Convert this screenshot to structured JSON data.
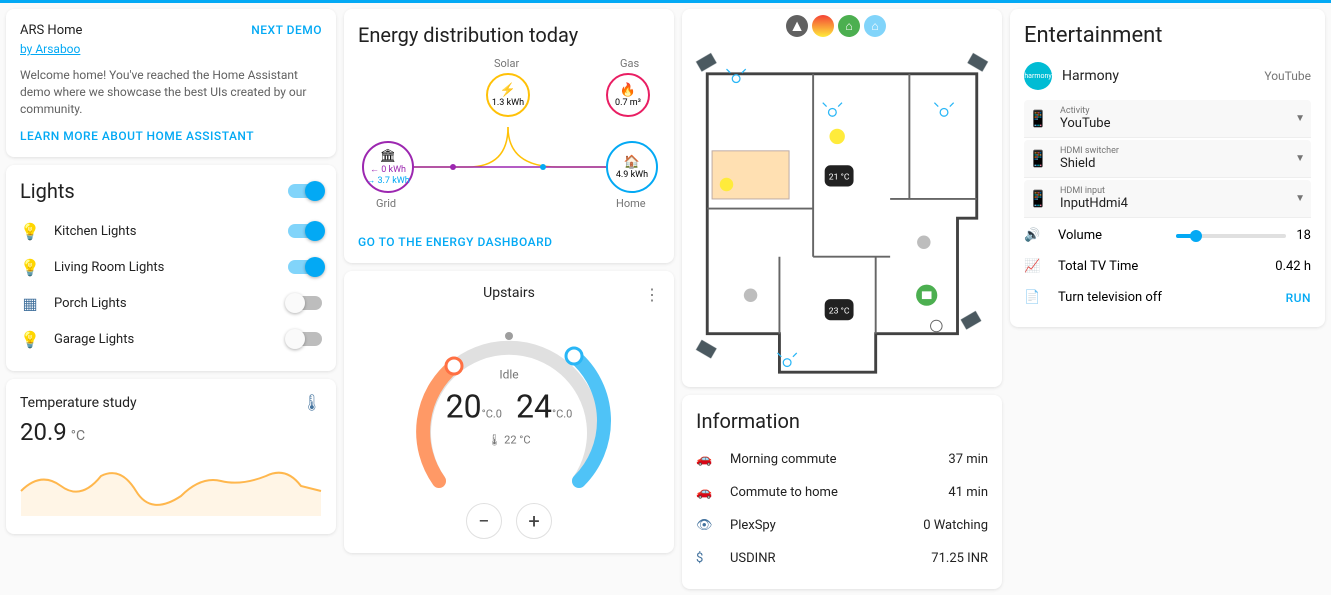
{
  "welcome": {
    "title": "ARS Home",
    "author": "by Arsaboo",
    "next_demo": "NEXT DEMO",
    "description": "Welcome home! You've reached the Home Assistant demo where we showcase the best UIs created by our community.",
    "learn_more": "LEARN MORE ABOUT HOME ASSISTANT"
  },
  "lights": {
    "title": "Lights",
    "master_on": true,
    "items": [
      {
        "name": "Kitchen Lights",
        "on": true,
        "color": "#ffb74d"
      },
      {
        "name": "Living Room Lights",
        "on": true,
        "color": "#ffc107"
      },
      {
        "name": "Porch Lights",
        "on": false,
        "color": "#44739e"
      },
      {
        "name": "Garage Lights",
        "on": false,
        "color": "#44739e"
      }
    ]
  },
  "temperature": {
    "title": "Temperature study",
    "value": "20.9",
    "unit": "°C"
  },
  "energy": {
    "title": "Energy distribution today",
    "solar_label": "Solar",
    "solar_value": "1.3 kWh",
    "gas_label": "Gas",
    "gas_value": "0.7 m³",
    "grid_label": "Grid",
    "grid_in": "← 0 kWh",
    "grid_out": "→ 3.7 kWh",
    "home_label": "Home",
    "home_value": "4.9 kWh",
    "link": "GO TO THE ENERGY DASHBOARD"
  },
  "thermostat": {
    "title": "Upstairs",
    "mode": "Idle",
    "low": "20",
    "high": "24",
    "dec": ".0",
    "unit_sup": "°C",
    "current_icon": "🌡",
    "current": "22 °C"
  },
  "floorplan": {
    "temps": {
      "living": "21 °C",
      "bedroom": "23 °C"
    }
  },
  "info": {
    "title": "Information",
    "rows": [
      {
        "icon": "car",
        "label": "Morning commute",
        "value": "37 min"
      },
      {
        "icon": "car",
        "label": "Commute to home",
        "value": "41 min"
      },
      {
        "icon": "eye",
        "label": "PlexSpy",
        "value": "0 Watching"
      },
      {
        "icon": "dollar",
        "label": "USDINR",
        "value": "71.25 INR"
      }
    ]
  },
  "entertainment": {
    "title": "Entertainment",
    "device": "Harmony",
    "status": "YouTube",
    "selects": [
      {
        "label": "Activity",
        "value": "YouTube"
      },
      {
        "label": "HDMI switcher",
        "value": "Shield"
      },
      {
        "label": "HDMI input",
        "value": "InputHdmi4"
      }
    ],
    "volume_label": "Volume",
    "volume_value": "18",
    "volume_pct": 18,
    "tv_time_label": "Total TV Time",
    "tv_time_value": "0.42 h",
    "turn_off_label": "Turn television off",
    "run": "RUN"
  }
}
